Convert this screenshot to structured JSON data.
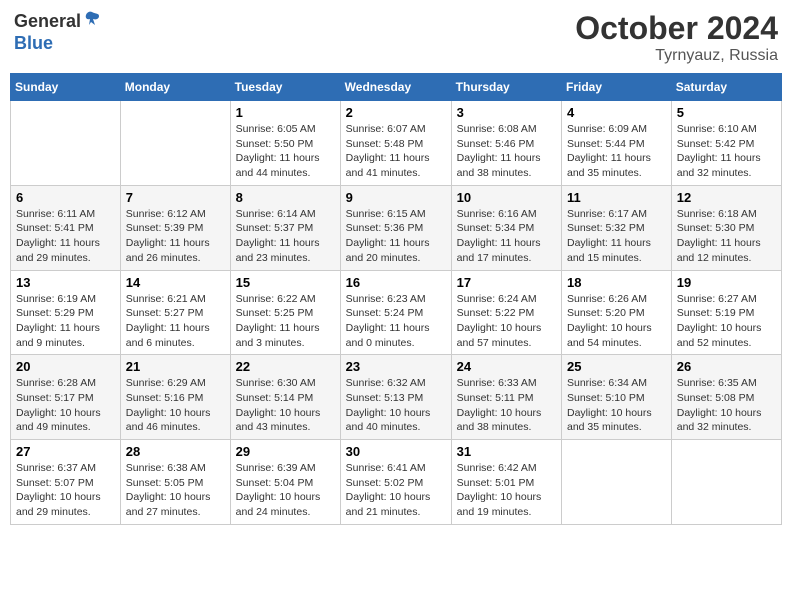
{
  "logo": {
    "general": "General",
    "blue": "Blue"
  },
  "title": "October 2024",
  "location": "Tyrnyauz, Russia",
  "days_header": [
    "Sunday",
    "Monday",
    "Tuesday",
    "Wednesday",
    "Thursday",
    "Friday",
    "Saturday"
  ],
  "weeks": [
    [
      {
        "day": "",
        "info": ""
      },
      {
        "day": "",
        "info": ""
      },
      {
        "day": "1",
        "sunrise": "Sunrise: 6:05 AM",
        "sunset": "Sunset: 5:50 PM",
        "daylight": "Daylight: 11 hours and 44 minutes."
      },
      {
        "day": "2",
        "sunrise": "Sunrise: 6:07 AM",
        "sunset": "Sunset: 5:48 PM",
        "daylight": "Daylight: 11 hours and 41 minutes."
      },
      {
        "day": "3",
        "sunrise": "Sunrise: 6:08 AM",
        "sunset": "Sunset: 5:46 PM",
        "daylight": "Daylight: 11 hours and 38 minutes."
      },
      {
        "day": "4",
        "sunrise": "Sunrise: 6:09 AM",
        "sunset": "Sunset: 5:44 PM",
        "daylight": "Daylight: 11 hours and 35 minutes."
      },
      {
        "day": "5",
        "sunrise": "Sunrise: 6:10 AM",
        "sunset": "Sunset: 5:42 PM",
        "daylight": "Daylight: 11 hours and 32 minutes."
      }
    ],
    [
      {
        "day": "6",
        "sunrise": "Sunrise: 6:11 AM",
        "sunset": "Sunset: 5:41 PM",
        "daylight": "Daylight: 11 hours and 29 minutes."
      },
      {
        "day": "7",
        "sunrise": "Sunrise: 6:12 AM",
        "sunset": "Sunset: 5:39 PM",
        "daylight": "Daylight: 11 hours and 26 minutes."
      },
      {
        "day": "8",
        "sunrise": "Sunrise: 6:14 AM",
        "sunset": "Sunset: 5:37 PM",
        "daylight": "Daylight: 11 hours and 23 minutes."
      },
      {
        "day": "9",
        "sunrise": "Sunrise: 6:15 AM",
        "sunset": "Sunset: 5:36 PM",
        "daylight": "Daylight: 11 hours and 20 minutes."
      },
      {
        "day": "10",
        "sunrise": "Sunrise: 6:16 AM",
        "sunset": "Sunset: 5:34 PM",
        "daylight": "Daylight: 11 hours and 17 minutes."
      },
      {
        "day": "11",
        "sunrise": "Sunrise: 6:17 AM",
        "sunset": "Sunset: 5:32 PM",
        "daylight": "Daylight: 11 hours and 15 minutes."
      },
      {
        "day": "12",
        "sunrise": "Sunrise: 6:18 AM",
        "sunset": "Sunset: 5:30 PM",
        "daylight": "Daylight: 11 hours and 12 minutes."
      }
    ],
    [
      {
        "day": "13",
        "sunrise": "Sunrise: 6:19 AM",
        "sunset": "Sunset: 5:29 PM",
        "daylight": "Daylight: 11 hours and 9 minutes."
      },
      {
        "day": "14",
        "sunrise": "Sunrise: 6:21 AM",
        "sunset": "Sunset: 5:27 PM",
        "daylight": "Daylight: 11 hours and 6 minutes."
      },
      {
        "day": "15",
        "sunrise": "Sunrise: 6:22 AM",
        "sunset": "Sunset: 5:25 PM",
        "daylight": "Daylight: 11 hours and 3 minutes."
      },
      {
        "day": "16",
        "sunrise": "Sunrise: 6:23 AM",
        "sunset": "Sunset: 5:24 PM",
        "daylight": "Daylight: 11 hours and 0 minutes."
      },
      {
        "day": "17",
        "sunrise": "Sunrise: 6:24 AM",
        "sunset": "Sunset: 5:22 PM",
        "daylight": "Daylight: 10 hours and 57 minutes."
      },
      {
        "day": "18",
        "sunrise": "Sunrise: 6:26 AM",
        "sunset": "Sunset: 5:20 PM",
        "daylight": "Daylight: 10 hours and 54 minutes."
      },
      {
        "day": "19",
        "sunrise": "Sunrise: 6:27 AM",
        "sunset": "Sunset: 5:19 PM",
        "daylight": "Daylight: 10 hours and 52 minutes."
      }
    ],
    [
      {
        "day": "20",
        "sunrise": "Sunrise: 6:28 AM",
        "sunset": "Sunset: 5:17 PM",
        "daylight": "Daylight: 10 hours and 49 minutes."
      },
      {
        "day": "21",
        "sunrise": "Sunrise: 6:29 AM",
        "sunset": "Sunset: 5:16 PM",
        "daylight": "Daylight: 10 hours and 46 minutes."
      },
      {
        "day": "22",
        "sunrise": "Sunrise: 6:30 AM",
        "sunset": "Sunset: 5:14 PM",
        "daylight": "Daylight: 10 hours and 43 minutes."
      },
      {
        "day": "23",
        "sunrise": "Sunrise: 6:32 AM",
        "sunset": "Sunset: 5:13 PM",
        "daylight": "Daylight: 10 hours and 40 minutes."
      },
      {
        "day": "24",
        "sunrise": "Sunrise: 6:33 AM",
        "sunset": "Sunset: 5:11 PM",
        "daylight": "Daylight: 10 hours and 38 minutes."
      },
      {
        "day": "25",
        "sunrise": "Sunrise: 6:34 AM",
        "sunset": "Sunset: 5:10 PM",
        "daylight": "Daylight: 10 hours and 35 minutes."
      },
      {
        "day": "26",
        "sunrise": "Sunrise: 6:35 AM",
        "sunset": "Sunset: 5:08 PM",
        "daylight": "Daylight: 10 hours and 32 minutes."
      }
    ],
    [
      {
        "day": "27",
        "sunrise": "Sunrise: 6:37 AM",
        "sunset": "Sunset: 5:07 PM",
        "daylight": "Daylight: 10 hours and 29 minutes."
      },
      {
        "day": "28",
        "sunrise": "Sunrise: 6:38 AM",
        "sunset": "Sunset: 5:05 PM",
        "daylight": "Daylight: 10 hours and 27 minutes."
      },
      {
        "day": "29",
        "sunrise": "Sunrise: 6:39 AM",
        "sunset": "Sunset: 5:04 PM",
        "daylight": "Daylight: 10 hours and 24 minutes."
      },
      {
        "day": "30",
        "sunrise": "Sunrise: 6:41 AM",
        "sunset": "Sunset: 5:02 PM",
        "daylight": "Daylight: 10 hours and 21 minutes."
      },
      {
        "day": "31",
        "sunrise": "Sunrise: 6:42 AM",
        "sunset": "Sunset: 5:01 PM",
        "daylight": "Daylight: 10 hours and 19 minutes."
      },
      {
        "day": "",
        "info": ""
      },
      {
        "day": "",
        "info": ""
      }
    ]
  ]
}
